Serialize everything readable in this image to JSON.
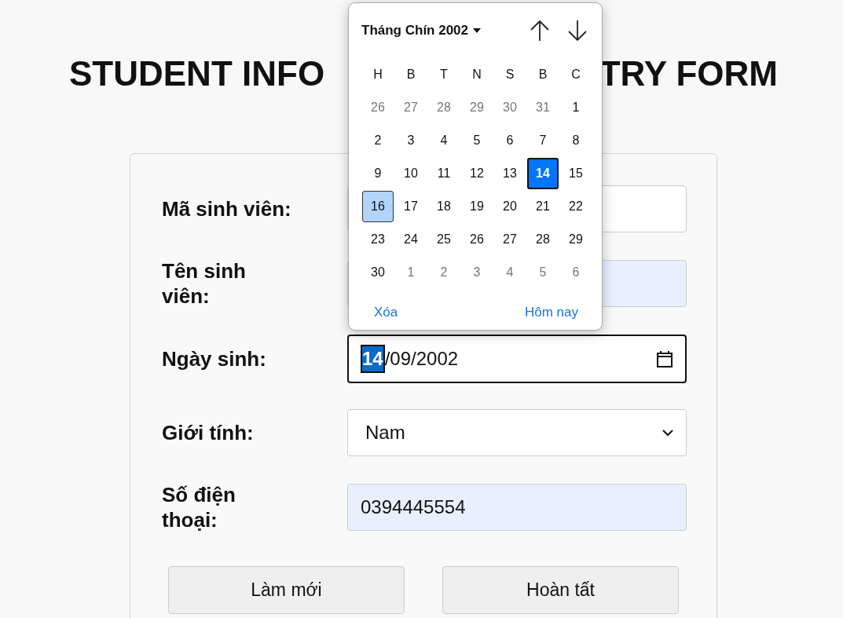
{
  "title_parts": [
    "STUDENT INFO",
    "TRY FORM"
  ],
  "form": {
    "fields": [
      {
        "kind": "text",
        "label": "Mã sinh viên:",
        "autofilled": false
      },
      {
        "kind": "text",
        "label": "Tên sinh viên:",
        "autofilled": true
      },
      {
        "kind": "date",
        "label": "Ngày sinh:",
        "focused": true,
        "value_parts": [
          {
            "text": "14",
            "selected": true
          },
          {
            "text": "/09/2002",
            "selected": false
          }
        ]
      },
      {
        "kind": "select",
        "label": "Giới tính:",
        "value": "Nam"
      },
      {
        "kind": "text",
        "label": "Số điện thoại:",
        "autofilled": true,
        "value": "0394445554"
      }
    ],
    "buttons": [
      "Làm mới",
      "Hoàn tất"
    ]
  },
  "calendar": {
    "month": "Tháng Chín 2002",
    "weekdays": [
      "H",
      "B",
      "T",
      "N",
      "S",
      "B",
      "C"
    ],
    "days": [
      {
        "text": "26",
        "muted": true,
        "selected": false,
        "highlighted": false
      },
      {
        "text": "27",
        "muted": true,
        "selected": false,
        "highlighted": false
      },
      {
        "text": "28",
        "muted": true,
        "selected": false,
        "highlighted": false
      },
      {
        "text": "29",
        "muted": true,
        "selected": false,
        "highlighted": false
      },
      {
        "text": "30",
        "muted": true,
        "selected": false,
        "highlighted": false
      },
      {
        "text": "31",
        "muted": true,
        "selected": false,
        "highlighted": false
      },
      {
        "text": "1",
        "muted": false,
        "selected": false,
        "highlighted": false
      },
      {
        "text": "2",
        "muted": false,
        "selected": false,
        "highlighted": false
      },
      {
        "text": "3",
        "muted": false,
        "selected": false,
        "highlighted": false
      },
      {
        "text": "4",
        "muted": false,
        "selected": false,
        "highlighted": false
      },
      {
        "text": "5",
        "muted": false,
        "selected": false,
        "highlighted": false
      },
      {
        "text": "6",
        "muted": false,
        "selected": false,
        "highlighted": false
      },
      {
        "text": "7",
        "muted": false,
        "selected": false,
        "highlighted": false
      },
      {
        "text": "8",
        "muted": false,
        "selected": false,
        "highlighted": false
      },
      {
        "text": "9",
        "muted": false,
        "selected": false,
        "highlighted": false
      },
      {
        "text": "10",
        "muted": false,
        "selected": false,
        "highlighted": false
      },
      {
        "text": "11",
        "muted": false,
        "selected": false,
        "highlighted": false
      },
      {
        "text": "12",
        "muted": false,
        "selected": false,
        "highlighted": false
      },
      {
        "text": "13",
        "muted": false,
        "selected": false,
        "highlighted": false
      },
      {
        "text": "14",
        "muted": false,
        "selected": true,
        "highlighted": false
      },
      {
        "text": "15",
        "muted": false,
        "selected": false,
        "highlighted": false
      },
      {
        "text": "16",
        "muted": false,
        "selected": false,
        "highlighted": true
      },
      {
        "text": "17",
        "muted": false,
        "selected": false,
        "highlighted": false
      },
      {
        "text": "18",
        "muted": false,
        "selected": false,
        "highlighted": false
      },
      {
        "text": "19",
        "muted": false,
        "selected": false,
        "highlighted": false
      },
      {
        "text": "20",
        "muted": false,
        "selected": false,
        "highlighted": false
      },
      {
        "text": "21",
        "muted": false,
        "selected": false,
        "highlighted": false
      },
      {
        "text": "22",
        "muted": false,
        "selected": false,
        "highlighted": false
      },
      {
        "text": "23",
        "muted": false,
        "selected": false,
        "highlighted": false
      },
      {
        "text": "24",
        "muted": false,
        "selected": false,
        "highlighted": false
      },
      {
        "text": "25",
        "muted": false,
        "selected": false,
        "highlighted": false
      },
      {
        "text": "26",
        "muted": false,
        "selected": false,
        "highlighted": false
      },
      {
        "text": "27",
        "muted": false,
        "selected": false,
        "highlighted": false
      },
      {
        "text": "28",
        "muted": false,
        "selected": false,
        "highlighted": false
      },
      {
        "text": "29",
        "muted": false,
        "selected": false,
        "highlighted": false
      },
      {
        "text": "30",
        "muted": false,
        "selected": false,
        "highlighted": false
      },
      {
        "text": "1",
        "muted": true,
        "selected": false,
        "highlighted": false
      },
      {
        "text": "2",
        "muted": true,
        "selected": false,
        "highlighted": false
      },
      {
        "text": "3",
        "muted": true,
        "selected": false,
        "highlighted": false
      },
      {
        "text": "4",
        "muted": true,
        "selected": false,
        "highlighted": false
      },
      {
        "text": "5",
        "muted": true,
        "selected": false,
        "highlighted": false
      },
      {
        "text": "6",
        "muted": true,
        "selected": false,
        "highlighted": false
      }
    ],
    "footer": [
      "Xóa",
      "Hôm nay"
    ]
  }
}
